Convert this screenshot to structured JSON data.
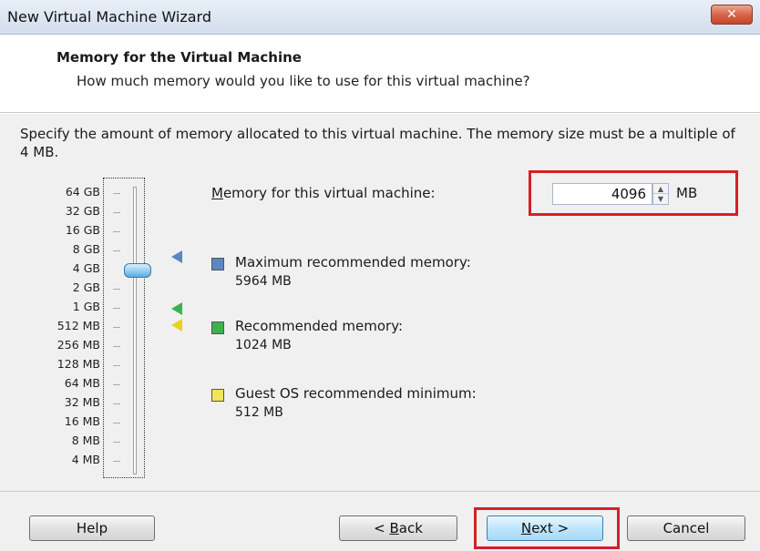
{
  "window": {
    "title": "New Virtual Machine Wizard",
    "close_icon": "close-icon"
  },
  "header": {
    "title": "Memory for the Virtual Machine",
    "subtitle": "How much memory would you like to use for this virtual machine?"
  },
  "description": "Specify the amount of memory allocated to this virtual machine. The memory size must be a multiple of 4 MB.",
  "scale_labels": [
    "64 GB",
    "32 GB",
    "16 GB",
    "8 GB",
    "4 GB",
    "2 GB",
    "1 GB",
    "512 MB",
    "256 MB",
    "128 MB",
    "64 MB",
    "32 MB",
    "16 MB",
    "8 MB",
    "4 MB"
  ],
  "memory": {
    "label_prefix": "",
    "label_accel": "M",
    "label_rest": "emory for this virtual machine:",
    "value": "4096",
    "unit": "MB"
  },
  "legend": [
    {
      "title": "Maximum recommended memory:",
      "value": "5964 MB",
      "color": "#5b86c4"
    },
    {
      "title": "Recommended memory:",
      "value": "1024 MB",
      "color": "#3cb34a"
    },
    {
      "title": "Guest OS recommended minimum:",
      "value": "512 MB",
      "color": "#f2e45a"
    }
  ],
  "buttons": {
    "help": "Help",
    "back_prefix": "< ",
    "back_accel": "B",
    "back_rest": "ack",
    "next_accel": "N",
    "next_rest": "ext >",
    "cancel": "Cancel"
  },
  "colors": {
    "highlight": "#d61f26"
  }
}
